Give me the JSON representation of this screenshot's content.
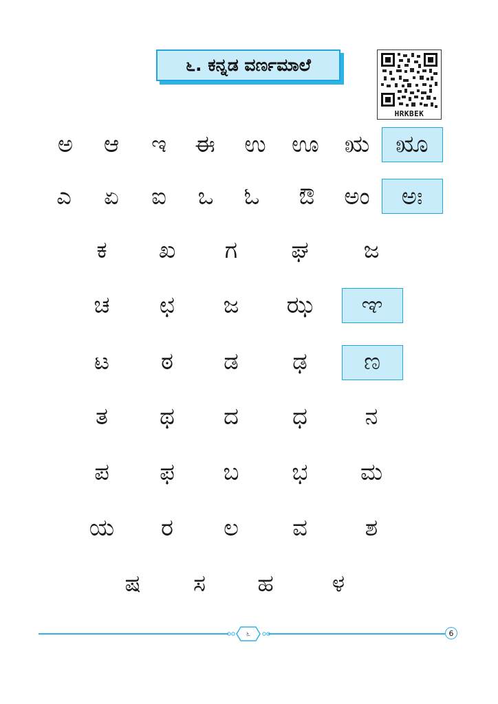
{
  "title": "೬. ಕನ್ನಡ ವರ್ಣಮಾಲೆ",
  "qr_code_label": "HRKBEK",
  "vowels_row1": [
    "ಅ",
    "ಆ",
    "ಇ",
    "ಈ",
    "ಉ",
    "ಊ",
    "ಋ",
    "ೠ"
  ],
  "vowels_row2": [
    "ಎ",
    "ಏ",
    "ಐ",
    "ಒ",
    "ಓ",
    "ಔ",
    "ಅಂ",
    "ಅಃ"
  ],
  "consonant_rows": [
    [
      "ಕ",
      "ಖ",
      "ಗ",
      "ಘ",
      "ಜ"
    ],
    [
      "ಚ",
      "ಛ",
      "ಜ",
      "ಝ",
      "ಞ"
    ],
    [
      "ಟ",
      "ಠ",
      "ಡ",
      "ಢ",
      "ಣ"
    ],
    [
      "ತ",
      "ಥ",
      "ದ",
      "ಧ",
      "ನ"
    ],
    [
      "ಪ",
      "ಫ",
      "ಬ",
      "ಭ",
      "ಮ"
    ],
    [
      "ಯ",
      "ರ",
      "ಲ",
      "ವ",
      "ಶ"
    ],
    [
      "ಷ",
      "ಸ",
      "ಹ",
      "ಳ"
    ]
  ],
  "footer_label": "೬",
  "page_number": "6",
  "colors": {
    "accent": "#1ea7df",
    "highlight_fill": "#c9ecfb"
  }
}
